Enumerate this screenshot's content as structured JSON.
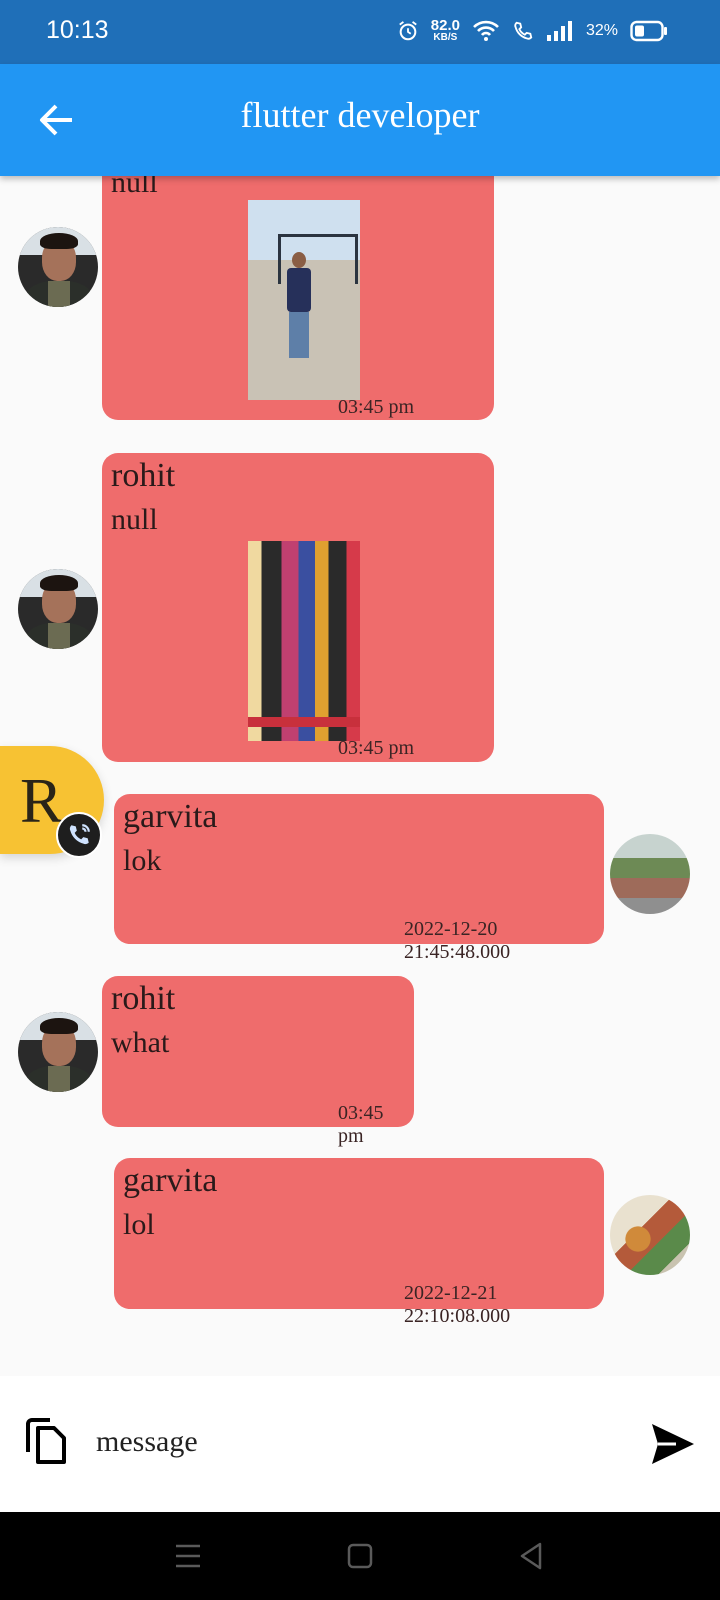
{
  "status_bar": {
    "time": "10:13",
    "net_speed_value": "82.0",
    "net_speed_unit": "KB/S",
    "battery_percent": "32%"
  },
  "app_bar": {
    "title": "flutter developer",
    "back_icon": "arrow-left-icon",
    "color": "#2196f3"
  },
  "messages": [
    {
      "sender": "",
      "text": "null",
      "has_image": true,
      "time": "03:45 pm",
      "side": "left",
      "avatar": "user-photo"
    },
    {
      "sender": "rohit",
      "text": "null",
      "has_image": true,
      "time": "03:45 pm",
      "side": "left",
      "avatar": "user-photo"
    },
    {
      "sender": "garvita",
      "text": "lok",
      "has_image": false,
      "time": "2022-12-20 21:45:48.000",
      "side": "right",
      "avatar": "house-photo"
    },
    {
      "sender": "rohit",
      "text": "what",
      "has_image": false,
      "time": "03:45 pm",
      "side": "left",
      "avatar": "user-photo"
    },
    {
      "sender": "garvita",
      "text": "lol",
      "has_image": false,
      "time": "2022-12-21 22:10:08.000",
      "side": "right",
      "avatar": "art-photo"
    }
  ],
  "bubble_color": "#ef6c6c",
  "floating_call": {
    "letter": "R",
    "icon": "phone-call-icon",
    "color": "#f7c233"
  },
  "composer": {
    "placeholder": "message",
    "attach_icon": "copy-icon",
    "send_icon": "send-icon"
  },
  "nav_bar": {
    "icons": [
      "menu-icon",
      "home-square-icon",
      "back-triangle-icon"
    ]
  }
}
